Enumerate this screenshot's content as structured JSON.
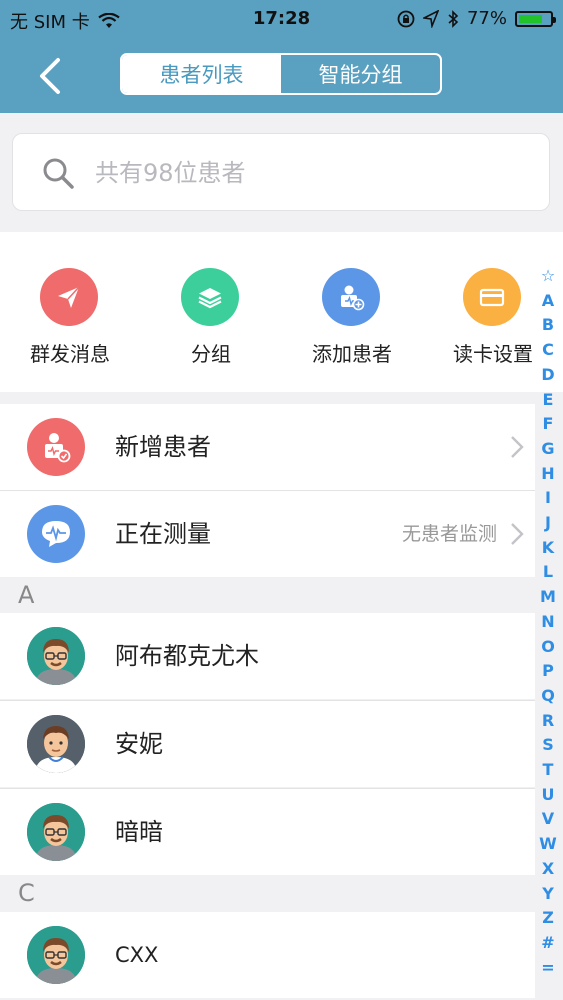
{
  "status_bar": {
    "carrier": "无 SIM 卡",
    "time": "17:28",
    "battery_percent": "77%",
    "battery_level": 0.77
  },
  "header": {
    "tabs": [
      {
        "label": "患者列表",
        "active": true
      },
      {
        "label": "智能分组",
        "active": false
      }
    ]
  },
  "search": {
    "placeholder": "共有98位患者"
  },
  "actions": [
    {
      "label": "群发消息",
      "color": "#f06b6b",
      "icon": "send-icon"
    },
    {
      "label": "分组",
      "color": "#3ccf9b",
      "icon": "layers-icon"
    },
    {
      "label": "添加患者",
      "color": "#5b97e6",
      "icon": "add-patient-icon"
    },
    {
      "label": "读卡设置",
      "color": "#fbb042",
      "icon": "card-icon"
    }
  ],
  "quick_rows": [
    {
      "label": "新增患者",
      "hint": "",
      "color": "#f06b6b"
    },
    {
      "label": "正在测量",
      "hint": "无患者监测",
      "color": "#5b97e6"
    }
  ],
  "sections": [
    {
      "letter": "A",
      "patients": [
        {
          "name": "阿布都克尤木"
        },
        {
          "name": "安妮"
        },
        {
          "name": "暗暗"
        }
      ]
    },
    {
      "letter": "C",
      "patients": [
        {
          "name": "CXX"
        }
      ]
    }
  ],
  "index_letters": [
    "☆",
    "A",
    "B",
    "C",
    "D",
    "E",
    "F",
    "G",
    "H",
    "I",
    "J",
    "K",
    "L",
    "M",
    "N",
    "O",
    "P",
    "Q",
    "R",
    "S",
    "T",
    "U",
    "V",
    "W",
    "X",
    "Y",
    "Z",
    "#",
    "="
  ],
  "colors": {
    "header_bg": "#5aa0c0",
    "accent_blue": "#2f8de3"
  }
}
